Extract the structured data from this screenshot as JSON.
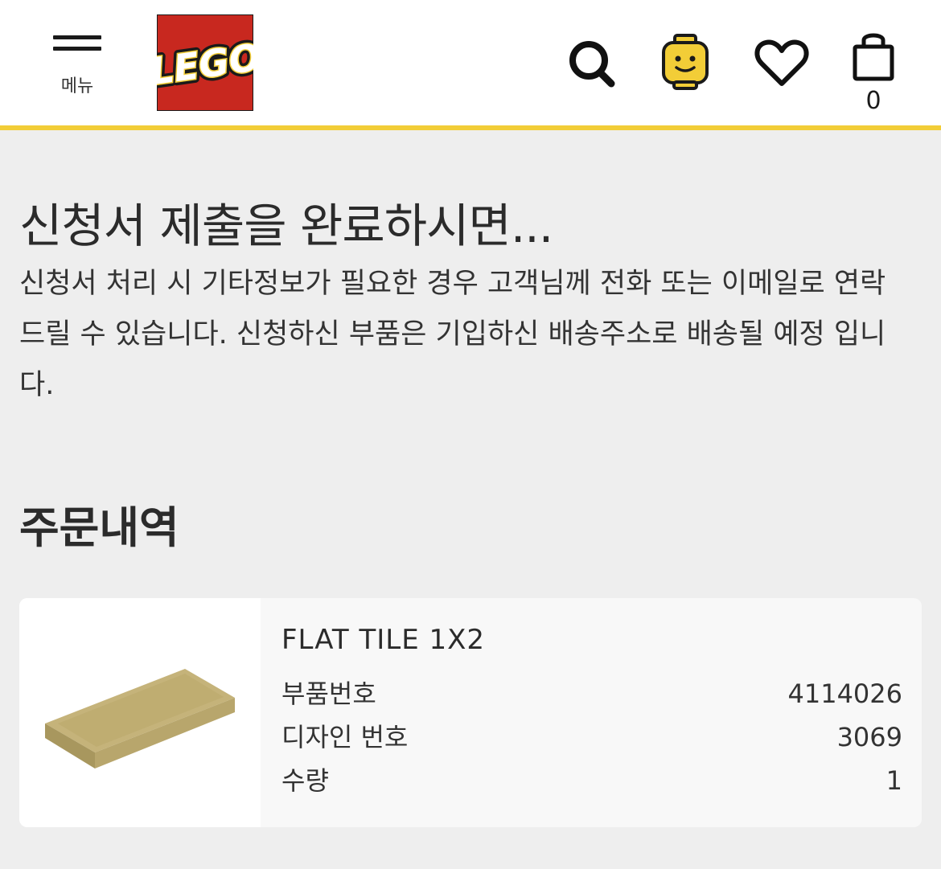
{
  "header": {
    "menu_label": "메뉴",
    "logo_text": "LEGO",
    "cart_count": "0",
    "accent_color": "#f2cd37",
    "logo_color": "#c8281f",
    "icons": [
      "menu-icon",
      "search-icon",
      "account-icon",
      "wishlist-icon",
      "cart-icon"
    ]
  },
  "main": {
    "title": "신청서 제출을 완료하시면...",
    "description": "신청서 처리 시 기타정보가 필요한 경우 고객님께 전화 또는 이메일로 연락 드릴 수 있습니다. 신청하신 부품은 기입하신 배송주소로 배송될 예정 입니다.",
    "order_section_title": "주문내역"
  },
  "order_item": {
    "name": "FLAT TILE 1X2",
    "image_icon": "flat-tile-1x2-tan",
    "details": [
      {
        "label": "부품번호",
        "value": "4114026"
      },
      {
        "label": "디자인 번호",
        "value": "3069"
      },
      {
        "label": "수량",
        "value": "1"
      }
    ]
  }
}
